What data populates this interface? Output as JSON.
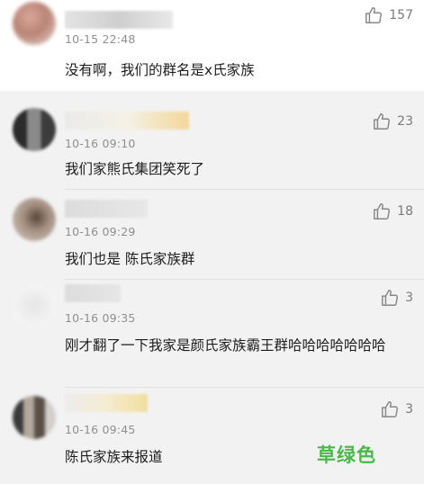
{
  "comments": [
    {
      "time": "10-15 22:48",
      "text": "没有啊，我们的群名是x氏家族",
      "likes": "157"
    },
    {
      "time": "10-16 09:10",
      "text": "我们家熊氏集团笑死了",
      "likes": "23"
    },
    {
      "time": "10-16 09:29",
      "text": "我们也是 陈氏家族群",
      "likes": "18"
    },
    {
      "time": "10-16 09:35",
      "text": "刚才翻了一下我家是颜氏家族霸王群哈哈哈哈哈哈哈",
      "likes": "3"
    },
    {
      "time": "10-16 09:45",
      "text": "陈氏家族来报道",
      "likes": "3"
    }
  ],
  "watermark": "草绿色",
  "icons": {
    "like": "thumbs-up-icon"
  },
  "colors": {
    "watermark": "#4bb84a",
    "timestamp": "#8f8f8f",
    "background": "#f2f2f2"
  }
}
